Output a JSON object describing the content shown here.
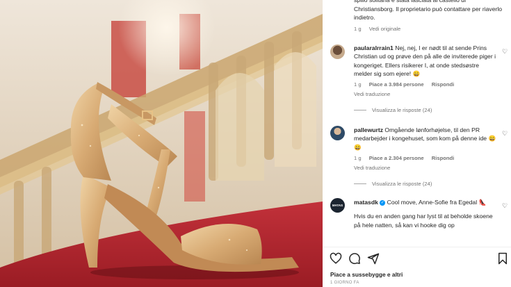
{
  "post": {
    "image_alt": "Gold glitter high-heeled sandal on a red carpeted staircase",
    "likes_text": "Piace a sussebygge e altri",
    "date_text": "1 GIORNO FA"
  },
  "caption_tail": {
    "text": "spillo solitaria è stata lasciata al castello di Christiansborg. Il proprietario può contattare per riaverlo indietro.",
    "time": "1 g",
    "see_original": "Vedi originale"
  },
  "comments": [
    {
      "username": "paularalrrain1",
      "text": "Nej, nej, I er nødt til at sende Prins Christian ud og prøve den på alle de inviterede piger i kongeriget. Ellers risikerer I, at onde stedsøstre melder sig som ejere! 😄",
      "time": "1 g",
      "likes": "Piace a 3.984 persone",
      "reply": "Rispondi",
      "translate": "Vedi traduzione",
      "replies": "Visualizza le risposte (24)"
    },
    {
      "username": "pallewurtz",
      "text": "Omgående lønforhøjelse, til den PR medarbejder i kongehuset, som kom på denne ide 😄😄",
      "time": "1 g",
      "likes": "Piace a 2.304 persone",
      "reply": "Rispondi",
      "translate": "Vedi traduzione",
      "replies": "Visualizza le risposte (24)"
    },
    {
      "username": "matasdk",
      "avatar_text": "MATAS",
      "text": "Cool move, Anne-Sofie fra Egedal 👠",
      "text2": "Hvis du en anden gang har lyst til at beholde skoene på hele natten, så kan vi hooke dig op"
    }
  ],
  "icons": {
    "like": "heart-icon",
    "comment": "comment-icon",
    "share": "send-icon",
    "save": "bookmark-icon",
    "verified": "verified-badge-icon"
  },
  "colors": {
    "carpet": "#b3232a",
    "shoe_gold": "#d9b27c",
    "verified_blue": "#0095f6",
    "text": "#262626",
    "muted": "#737373"
  }
}
